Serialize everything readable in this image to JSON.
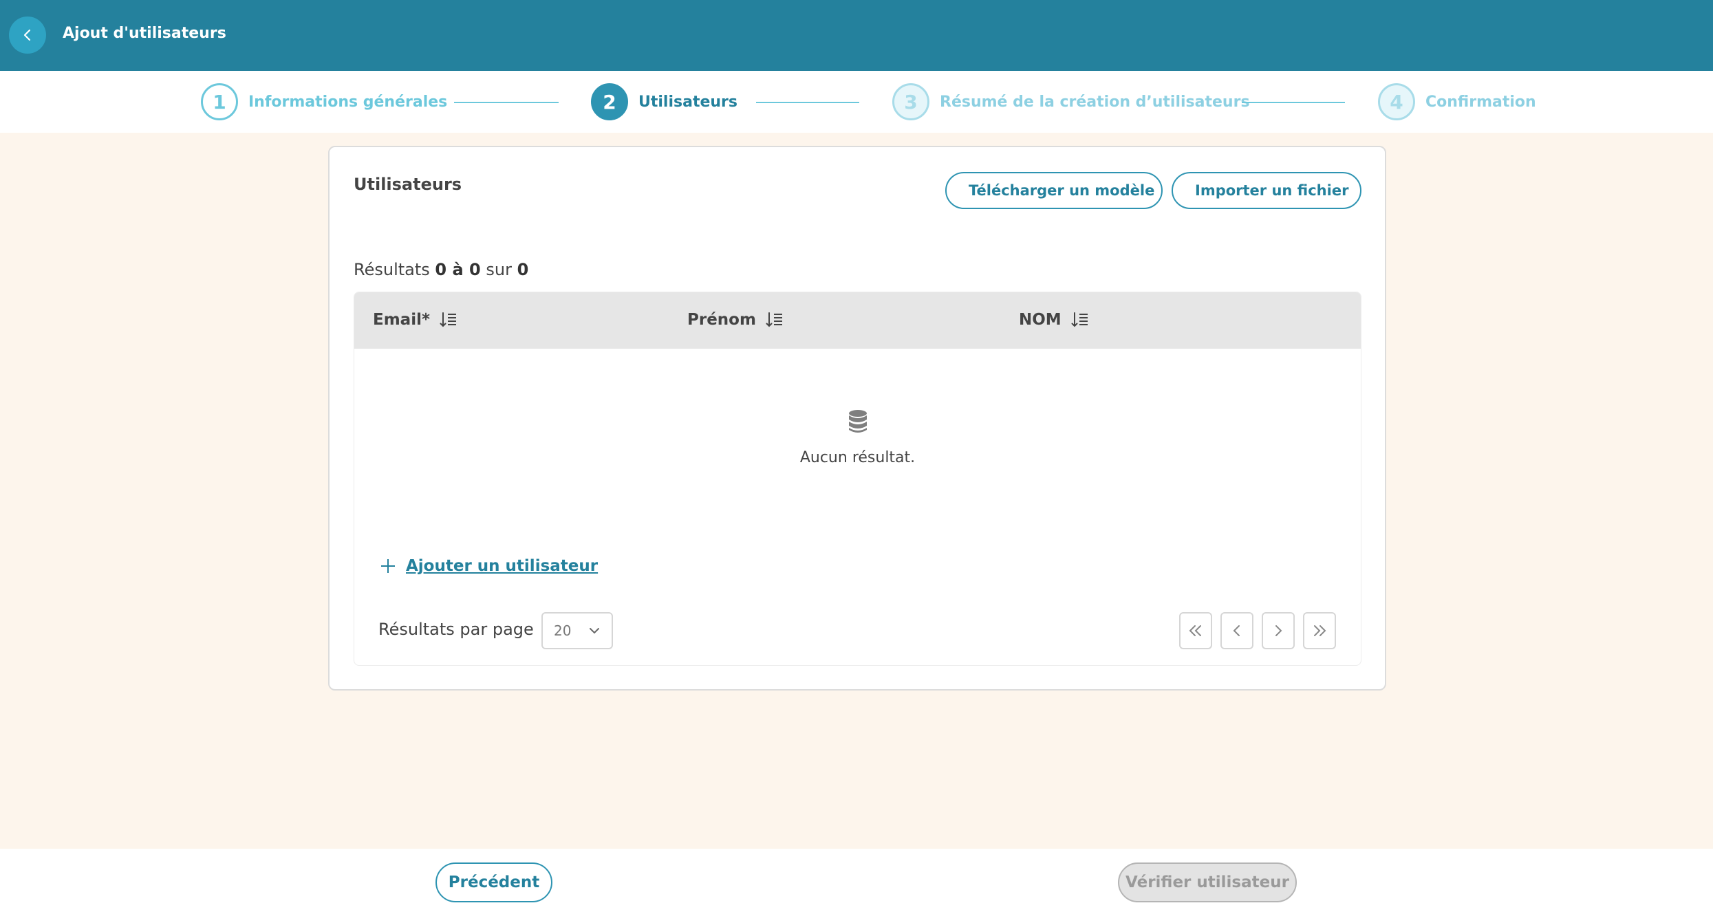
{
  "header": {
    "title": "Ajout d'utilisateurs",
    "back_icon": "chevron-left-icon"
  },
  "stepper": {
    "steps": [
      {
        "number": "1",
        "label": "Informations générales",
        "state": "completed"
      },
      {
        "number": "2",
        "label": "Utilisateurs",
        "state": "active"
      },
      {
        "number": "3",
        "label": "Résumé de la création d’utilisateurs",
        "state": "pending"
      },
      {
        "number": "4",
        "label": "Confirmation",
        "state": "pending"
      }
    ]
  },
  "card": {
    "title": "Utilisateurs",
    "download_template_label": "Télécharger un modèle",
    "import_file_label": "Importer un fichier",
    "results": {
      "prefix": "Résultats",
      "range": "0 à 0",
      "of": "sur",
      "total": "0"
    },
    "table": {
      "columns": [
        {
          "label": "Email*",
          "icon": "sort-icon"
        },
        {
          "label": "Prénom",
          "icon": "sort-icon"
        },
        {
          "label": "NOM",
          "icon": "sort-icon"
        }
      ],
      "rows": [],
      "empty_icon": "database-icon",
      "empty_text": "Aucun résultat."
    },
    "add_user_label": "Ajouter un utilisateur",
    "pagination": {
      "per_page_label": "Résultats par page",
      "per_page_value": "20",
      "buttons": [
        "first-page",
        "previous-page",
        "next-page",
        "last-page"
      ]
    }
  },
  "footer": {
    "previous_label": "Précédent",
    "verify_label": "Vérifier utilisateur"
  },
  "colors": {
    "header_bg": "#24819d",
    "accent": "#2e94b2",
    "light_accent": "#6cc8dc",
    "page_bg": "#fdf5ec",
    "disabled_bg": "#e3e3e3"
  }
}
